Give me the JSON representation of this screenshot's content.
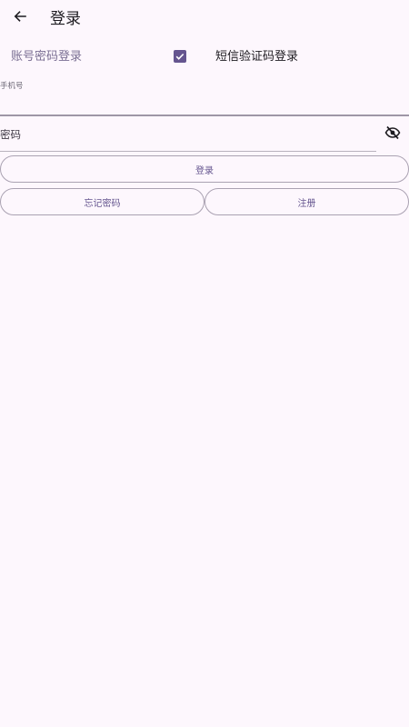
{
  "header": {
    "title": "登录",
    "back_icon": "arrow-left-icon"
  },
  "login_mode": {
    "account_password_label": "账号密码登录",
    "sms_code_label": "短信验证码登录",
    "sms_checked": true,
    "accent_color": "#65558f"
  },
  "form": {
    "phone_label": "手机号",
    "phone_value": "",
    "password_label": "密码",
    "password_value": "",
    "password_visibility_icon": "eye-off-icon"
  },
  "actions": {
    "login_label": "登录",
    "forgot_password_label": "忘记密码",
    "register_label": "注册"
  },
  "colors": {
    "background": "#fdf7fd",
    "outline": "#aaa2b2",
    "primary": "#65558f"
  }
}
